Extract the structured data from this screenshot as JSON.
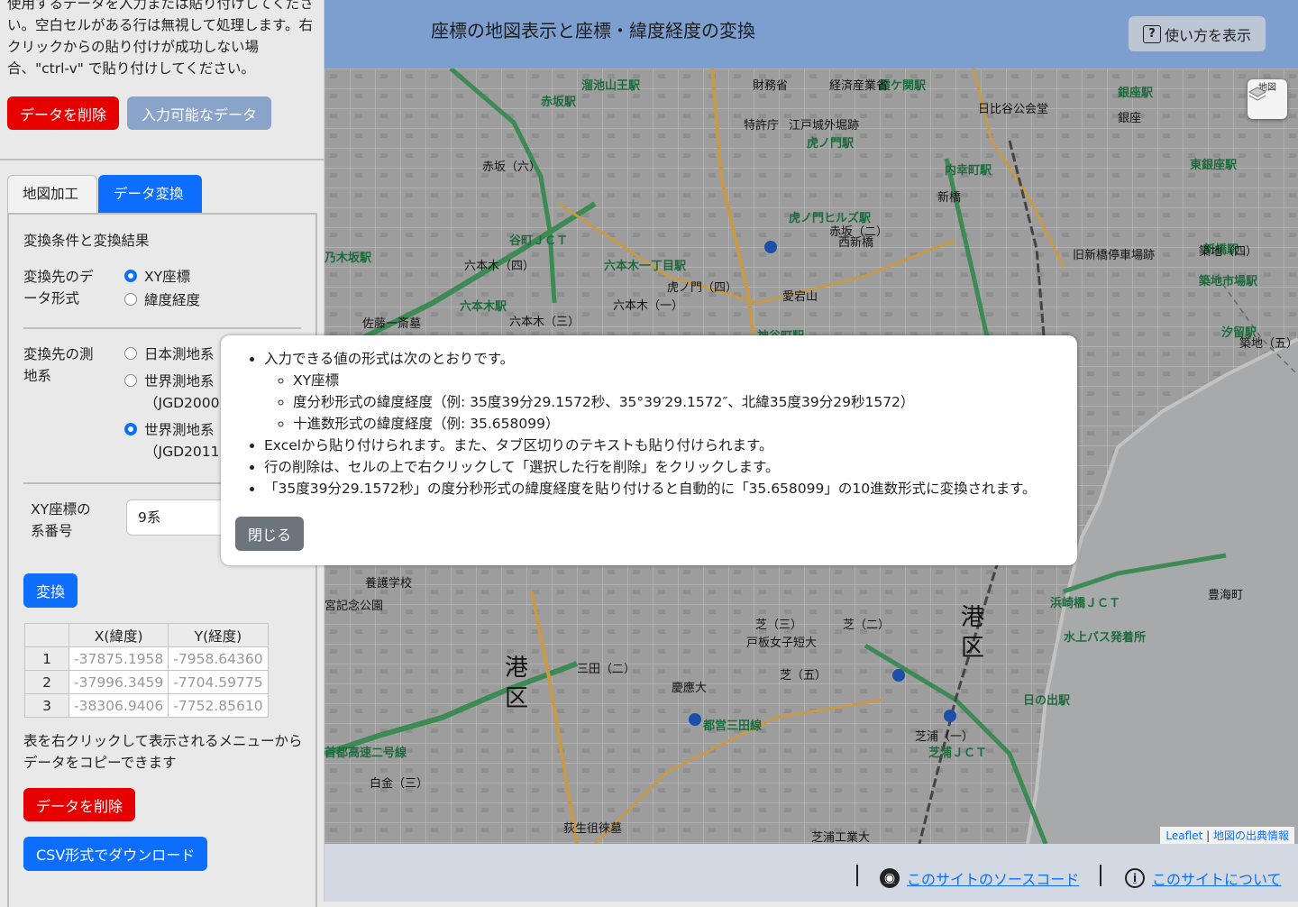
{
  "header": {
    "title": "座標の地図表示と座標・緯度経度の変換",
    "help_label": "使い方を表示",
    "help_icon": "question-square-icon"
  },
  "sidebar": {
    "instructions": "使用するデータを入力または貼り付けしてください。空白セルがある行は無視して処理します。右クリックからの貼り付けが成功しない場合、\"ctrl-v\" で貼り付けしてください。",
    "delete_data_label": "データを削除",
    "allowed_data_label": "入力可能なデータ",
    "tabs": [
      {
        "label": "地図加工",
        "active": false
      },
      {
        "label": "データ変換",
        "active": true
      }
    ],
    "panel_title": "変換条件と変換結果",
    "format_label": "変換先のデータ形式",
    "format_options": [
      {
        "label": "XY座標",
        "checked": true
      },
      {
        "label": "緯度経度",
        "checked": false
      }
    ],
    "datum_label": "変換先の測地系",
    "datum_options": [
      {
        "label": "日本測地系",
        "sub": "",
        "checked": false
      },
      {
        "label": "世界測地系",
        "sub": "（JGD2000",
        "checked": false
      },
      {
        "label": "世界測地系",
        "sub": "（JGD2011",
        "checked": true
      }
    ],
    "zone_label": "XY座標の系番号",
    "zone_value": "9系",
    "convert_label": "変換",
    "table": {
      "headers": [
        "X(緯度)",
        "Y(経度)"
      ],
      "rows": [
        {
          "n": "1",
          "x": "-37875.1958",
          "y": "-7958.64360"
        },
        {
          "n": "2",
          "x": "-37996.3459",
          "y": "-7704.59775"
        },
        {
          "n": "3",
          "x": "-38306.9406",
          "y": "-7752.85610"
        }
      ]
    },
    "copy_note": "表を右クリックして表示されるメニューからデータをコピーできます",
    "delete_data_label2": "データを削除",
    "csv_label": "CSV形式でダウンロード"
  },
  "map": {
    "layer_button_label": "地図",
    "attribution_leaflet": "Leaflet",
    "attribution_sep": "|",
    "attribution_source": "地図の出典情報",
    "labels": [
      {
        "text": "赤坂駅",
        "green": true
      },
      {
        "text": "溜池山王駅",
        "green": true
      },
      {
        "text": "霞ケ関駅",
        "green": true
      },
      {
        "text": "虎ノ門駅",
        "green": true
      },
      {
        "text": "銀座駅",
        "green": true
      },
      {
        "text": "内幸町駅",
        "green": true
      },
      {
        "text": "東銀座駅",
        "green": true
      },
      {
        "text": "新橋駅",
        "green": true
      },
      {
        "text": "汐留駅",
        "green": true
      },
      {
        "text": "神谷町駅",
        "green": true
      },
      {
        "text": "虎ノ門ヒルズ駅",
        "green": true
      },
      {
        "text": "六本木一丁目駅",
        "green": true
      },
      {
        "text": "乃木坂駅",
        "green": true
      },
      {
        "text": "六本木駅",
        "green": true
      },
      {
        "text": "谷町ＪＣＴ",
        "green": true
      },
      {
        "text": "築地市場駅",
        "green": true
      },
      {
        "text": "都営三田線",
        "green": true
      },
      {
        "text": "浜崎橋ＪＣＴ",
        "green": true
      },
      {
        "text": "水上バス発着所",
        "green": true
      },
      {
        "text": "芝浦ＪＣＴ",
        "green": true
      },
      {
        "text": "日の出駅",
        "green": true
      },
      {
        "text": "首都高速二号線",
        "green": true
      },
      {
        "text": "赤坂（二）",
        "green": false
      },
      {
        "text": "赤坂（六）",
        "green": false
      },
      {
        "text": "六本木（四）",
        "green": false
      },
      {
        "text": "六本木（三）",
        "green": false
      },
      {
        "text": "六本木（一）",
        "green": false
      },
      {
        "text": "虎ノ門（四）",
        "green": false
      },
      {
        "text": "愛宕山",
        "green": false
      },
      {
        "text": "西新橋",
        "green": false
      },
      {
        "text": "新橋",
        "green": false
      },
      {
        "text": "築地（四）",
        "green": false
      },
      {
        "text": "築地（五）",
        "green": false
      },
      {
        "text": "銀座",
        "green": false
      },
      {
        "text": "財務省",
        "green": false
      },
      {
        "text": "経済産業省",
        "green": false
      },
      {
        "text": "特許庁",
        "green": false
      },
      {
        "text": "江戸城外堀跡",
        "green": false
      },
      {
        "text": "日比谷公会堂",
        "green": false
      },
      {
        "text": "旧新橋停車場跡",
        "green": false
      },
      {
        "text": "佐藤一斎墓",
        "green": false
      },
      {
        "text": "三田（二）",
        "green": false
      },
      {
        "text": "芝（三）",
        "green": false
      },
      {
        "text": "芝（五）",
        "green": false
      },
      {
        "text": "芝（二）",
        "green": false
      },
      {
        "text": "慶應大",
        "green": false
      },
      {
        "text": "戸板女子短大",
        "green": false
      },
      {
        "text": "芝浦（一）",
        "green": false
      },
      {
        "text": "芝浦工業大",
        "green": false
      },
      {
        "text": "豊海町",
        "green": false
      },
      {
        "text": "荻生徂徠墓",
        "green": false
      },
      {
        "text": "養護学校",
        "green": false
      },
      {
        "text": "白金（三）",
        "green": false
      },
      {
        "text": "宮記念公園",
        "green": false
      },
      {
        "text": "港区",
        "green": false,
        "big": true
      }
    ]
  },
  "modal": {
    "bullets": [
      {
        "text": "入力できる値の形式は次のとおりです。",
        "children": [
          "XY座標",
          "度分秒形式の緯度経度（例: 35度39分29.1572秒、35°39′29.1572″、北緯35度39分29秒1572）",
          "十進数形式の緯度経度（例: 35.658099）"
        ]
      },
      {
        "text": "Excelから貼り付けられます。また、タブ区切りのテキストも貼り付けられます。",
        "children": []
      },
      {
        "text": "行の削除は、セルの上で右クリックして「選択した行を削除」をクリックします。",
        "children": []
      },
      {
        "text": "「35度39分29.1572秒」の度分秒形式の緯度経度を貼り付けると自動的に「35.658099」の10進数形式に変換されます。",
        "children": []
      }
    ],
    "close_label": "閉じる"
  },
  "footer": {
    "source_label": "このサイトのソースコード",
    "about_label": "このサイトについて",
    "github_icon": "github-icon",
    "info_icon": "info-circle-icon"
  },
  "colors": {
    "header_bg": "#7d9fcf",
    "primary": "#0d6efd",
    "danger": "#e60000",
    "secondary": "#6c757d",
    "map_green": "#1d6b3c"
  }
}
